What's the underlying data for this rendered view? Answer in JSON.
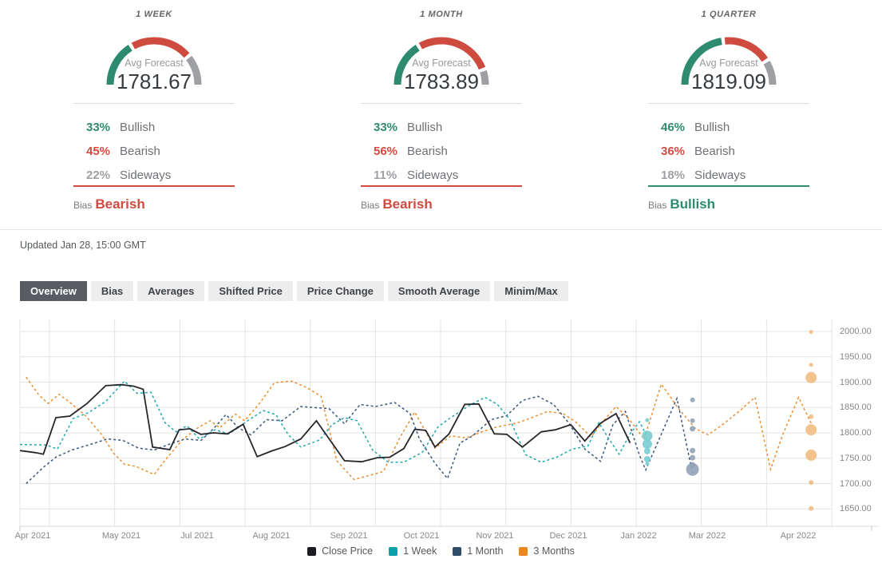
{
  "labels": {
    "updated": "Updated Jan 28, 15:00 GMT"
  },
  "colors": {
    "bullish": "#2e8b6f",
    "bearish": "#cf4b3f",
    "sideways": "#9ea0a3",
    "active_tab_bg": "#595d61",
    "grid": "#e4e4e4",
    "axis_text": "#85888b"
  },
  "cards": [
    {
      "period": "1 WEEK",
      "avg_label": "Avg Forecast",
      "avg_forecast": "1781.67",
      "bullish_pct": "33%",
      "bullish_label": "Bullish",
      "bearish_pct": "45%",
      "bearish_label": "Bearish",
      "sideways_pct": "22%",
      "sideways_label": "Sideways",
      "bias_label": "Bias",
      "bias": "Bearish",
      "bias_direction": "bearish",
      "gauge": {
        "bullish": 33,
        "bearish": 45,
        "sideways": 22
      }
    },
    {
      "period": "1 MONTH",
      "avg_label": "Avg Forecast",
      "avg_forecast": "1783.89",
      "bullish_pct": "33%",
      "bullish_label": "Bullish",
      "bearish_pct": "56%",
      "bearish_label": "Bearish",
      "sideways_pct": "11%",
      "sideways_label": "Sideways",
      "bias_label": "Bias",
      "bias": "Bearish",
      "bias_direction": "bearish",
      "gauge": {
        "bullish": 33,
        "bearish": 56,
        "sideways": 11
      }
    },
    {
      "period": "1 QUARTER",
      "avg_label": "Avg Forecast",
      "avg_forecast": "1819.09",
      "bullish_pct": "46%",
      "bullish_label": "Bullish",
      "bearish_pct": "36%",
      "bearish_label": "Bearish",
      "sideways_pct": "18%",
      "sideways_label": "Sideways",
      "bias_label": "Bias",
      "bias": "Bullish",
      "bias_direction": "bullish",
      "gauge": {
        "bullish": 46,
        "bearish": 36,
        "sideways": 18
      }
    }
  ],
  "tabs": {
    "active": "Overview",
    "items": [
      {
        "label": "Overview"
      },
      {
        "label": "Bias"
      },
      {
        "label": "Averages"
      },
      {
        "label": "Shifted Price"
      },
      {
        "label": "Price Change"
      },
      {
        "label": "Smooth Average"
      },
      {
        "label": "Minim/Max"
      }
    ]
  },
  "chart_data": {
    "type": "line",
    "title": "",
    "xlabel": "",
    "ylabel": "",
    "x_unit": "weeks since Apr 2021 (close price history + forecast horizons)",
    "x_axis": {
      "tick_labels": [
        "Apr 2021",
        "May 2021",
        "Jul 2021",
        "Aug 2021",
        "Sep 2021",
        "Oct 2021",
        "Nov 2021",
        "Dec 2021",
        "Jan 2022",
        "Mar 2022",
        "Apr 2022"
      ]
    },
    "y_axis": {
      "tick_labels": [
        "2000.00",
        "1950.00",
        "1900.00",
        "1850.00",
        "1800.00",
        "1750.00",
        "1700.00",
        "1650.00"
      ],
      "min": 1615,
      "max": 2025,
      "grid": true
    },
    "legend": {
      "position": "bottom",
      "items": [
        {
          "label": "Close Price",
          "color": "#1c1d22"
        },
        {
          "label": "1 Week",
          "color": "#0aa2a8"
        },
        {
          "label": "1 Month",
          "color": "#2f4d6b"
        },
        {
          "label": "3 Months",
          "color": "#e8891d"
        }
      ]
    },
    "series": [
      {
        "name": "Close Price",
        "style": "solid",
        "color": "#26262c",
        "points": [
          [
            0,
            1765
          ],
          [
            1,
            1761
          ],
          [
            1.5,
            1758
          ],
          [
            2.3,
            1830
          ],
          [
            3.2,
            1833
          ],
          [
            4.3,
            1858
          ],
          [
            5.5,
            1893
          ],
          [
            6.5,
            1895
          ],
          [
            7.3,
            1892
          ],
          [
            7.9,
            1886
          ],
          [
            8.5,
            1772
          ],
          [
            9.6,
            1767
          ],
          [
            10.2,
            1806
          ],
          [
            10.9,
            1808
          ],
          [
            11.6,
            1797
          ],
          [
            12.4,
            1800
          ],
          [
            13.3,
            1798
          ],
          [
            14.3,
            1817
          ],
          [
            15.2,
            1753
          ],
          [
            16.1,
            1764
          ],
          [
            17,
            1773
          ],
          [
            18,
            1788
          ],
          [
            19,
            1824
          ],
          [
            20.8,
            1745
          ],
          [
            21.9,
            1743
          ],
          [
            22.9,
            1751
          ],
          [
            23.7,
            1752
          ],
          [
            24.6,
            1769
          ],
          [
            25.3,
            1807
          ],
          [
            26,
            1805
          ],
          [
            26.6,
            1772
          ],
          [
            27.5,
            1798
          ],
          [
            28.5,
            1856
          ],
          [
            29.4,
            1857
          ],
          [
            30.4,
            1798
          ],
          [
            31.2,
            1797
          ],
          [
            32.2,
            1772
          ],
          [
            33.4,
            1802
          ],
          [
            34.3,
            1806
          ],
          [
            35.3,
            1816
          ],
          [
            36.2,
            1784
          ],
          [
            37.2,
            1819
          ],
          [
            38.2,
            1838
          ],
          [
            39.1,
            1780
          ]
        ]
      },
      {
        "name": "1 Week",
        "style": "dashed",
        "color": "#1fa9af",
        "points": [
          [
            0,
            1777
          ],
          [
            1.7,
            1776
          ],
          [
            2.4,
            1768
          ],
          [
            3.4,
            1828
          ],
          [
            4.4,
            1840
          ],
          [
            5.5,
            1862
          ],
          [
            6.7,
            1902
          ],
          [
            7.5,
            1878
          ],
          [
            8.4,
            1880
          ],
          [
            9.3,
            1820
          ],
          [
            10,
            1802
          ],
          [
            10.7,
            1814
          ],
          [
            11.5,
            1788
          ],
          [
            12.5,
            1806
          ],
          [
            13.4,
            1798
          ],
          [
            14.6,
            1824
          ],
          [
            15.6,
            1844
          ],
          [
            16.4,
            1836
          ],
          [
            17.2,
            1796
          ],
          [
            18,
            1772
          ],
          [
            19.2,
            1786
          ],
          [
            20,
            1816
          ],
          [
            20.8,
            1830
          ],
          [
            21.6,
            1824
          ],
          [
            22.6,
            1766
          ],
          [
            23.6,
            1742
          ],
          [
            24.6,
            1742
          ],
          [
            25.8,
            1762
          ],
          [
            26.8,
            1812
          ],
          [
            27.6,
            1830
          ],
          [
            28.8,
            1854
          ],
          [
            29.8,
            1870
          ],
          [
            30.6,
            1856
          ],
          [
            31.4,
            1826
          ],
          [
            32.4,
            1757
          ],
          [
            33.4,
            1742
          ],
          [
            34.4,
            1752
          ],
          [
            35.4,
            1768
          ],
          [
            36.4,
            1774
          ],
          [
            37.1,
            1820
          ],
          [
            37.7,
            1790
          ],
          [
            38.4,
            1758
          ],
          [
            39.1,
            1798
          ],
          [
            39.7,
            1822
          ],
          [
            40.2,
            1792
          ]
        ],
        "forecast_dots": {
          "x": 40.2,
          "color": "#79ccd1",
          "points": [
            [
              1825,
              2.5
            ],
            [
              1794,
              6.5
            ],
            [
              1778,
              6
            ],
            [
              1764,
              4
            ],
            [
              1748,
              4
            ],
            [
              1739,
              2.5
            ]
          ]
        }
      },
      {
        "name": "1 Month",
        "style": "dashed",
        "color": "#3a567a",
        "points": [
          [
            0.4,
            1700
          ],
          [
            1.5,
            1732
          ],
          [
            2.3,
            1752
          ],
          [
            3.3,
            1766
          ],
          [
            4.6,
            1778
          ],
          [
            5.6,
            1788
          ],
          [
            6.6,
            1785
          ],
          [
            7.6,
            1770
          ],
          [
            8.6,
            1766
          ],
          [
            9.6,
            1778
          ],
          [
            10.6,
            1788
          ],
          [
            11.6,
            1785
          ],
          [
            12.4,
            1808
          ],
          [
            13.2,
            1836
          ],
          [
            14,
            1810
          ],
          [
            14.8,
            1796
          ],
          [
            15.8,
            1826
          ],
          [
            16.8,
            1824
          ],
          [
            18,
            1852
          ],
          [
            18.8,
            1850
          ],
          [
            19.8,
            1848
          ],
          [
            20.8,
            1818
          ],
          [
            21.8,
            1856
          ],
          [
            22.8,
            1852
          ],
          [
            24,
            1860
          ],
          [
            25,
            1838
          ],
          [
            25.6,
            1788
          ],
          [
            26.6,
            1740
          ],
          [
            27.4,
            1710
          ],
          [
            28.2,
            1780
          ],
          [
            29,
            1794
          ],
          [
            30.2,
            1826
          ],
          [
            31.2,
            1834
          ],
          [
            32.2,
            1864
          ],
          [
            33.2,
            1872
          ],
          [
            34.2,
            1856
          ],
          [
            35.2,
            1818
          ],
          [
            36.2,
            1768
          ],
          [
            37.2,
            1744
          ],
          [
            38,
            1816
          ],
          [
            38.8,
            1842
          ],
          [
            39.7,
            1756
          ],
          [
            40.1,
            1727
          ],
          [
            42.1,
            1868
          ],
          [
            43.1,
            1720
          ]
        ],
        "forecast_dots": {
          "x": 43.1,
          "color": "#94a2b6",
          "points": [
            [
              1865,
              3
            ],
            [
              1824,
              3
            ],
            [
              1808,
              3.5
            ],
            [
              1765,
              3.5
            ],
            [
              1751,
              3.5
            ],
            [
              1737,
              3.5
            ],
            [
              1728,
              8
            ]
          ]
        }
      },
      {
        "name": "3 Months",
        "style": "dashed",
        "color": "#ea9030",
        "points": [
          [
            0.4,
            1910
          ],
          [
            1.2,
            1875
          ],
          [
            1.8,
            1858
          ],
          [
            2.5,
            1876
          ],
          [
            3.2,
            1860
          ],
          [
            4.2,
            1834
          ],
          [
            5.2,
            1798
          ],
          [
            6,
            1760
          ],
          [
            6.7,
            1738
          ],
          [
            7.4,
            1734
          ],
          [
            8.6,
            1718
          ],
          [
            9.4,
            1750
          ],
          [
            10.4,
            1786
          ],
          [
            11.4,
            1810
          ],
          [
            12.2,
            1824
          ],
          [
            12.8,
            1810
          ],
          [
            13.8,
            1837
          ],
          [
            14.4,
            1824
          ],
          [
            15.4,
            1860
          ],
          [
            16.3,
            1899
          ],
          [
            17.4,
            1902
          ],
          [
            18.4,
            1889
          ],
          [
            19.3,
            1872
          ],
          [
            20.3,
            1745
          ],
          [
            21.4,
            1708
          ],
          [
            22.4,
            1716
          ],
          [
            23.3,
            1724
          ],
          [
            24.3,
            1788
          ],
          [
            25.3,
            1841
          ],
          [
            26.6,
            1770
          ],
          [
            27.6,
            1794
          ],
          [
            28.6,
            1790
          ],
          [
            29.6,
            1802
          ],
          [
            30.6,
            1812
          ],
          [
            31.8,
            1819
          ],
          [
            32.8,
            1830
          ],
          [
            33.8,
            1842
          ],
          [
            34.8,
            1838
          ],
          [
            35.6,
            1822
          ],
          [
            36.6,
            1792
          ],
          [
            37.4,
            1824
          ],
          [
            38.2,
            1852
          ],
          [
            39,
            1828
          ],
          [
            40,
            1788
          ],
          [
            41.1,
            1896
          ],
          [
            42.2,
            1848
          ],
          [
            43.3,
            1808
          ],
          [
            44.1,
            1796
          ],
          [
            45.1,
            1818
          ],
          [
            46.1,
            1843
          ],
          [
            47.1,
            1870
          ],
          [
            48.1,
            1728
          ],
          [
            48.9,
            1798
          ],
          [
            49.9,
            1870
          ],
          [
            50.8,
            1813
          ]
        ],
        "forecast_dots": {
          "x": 50.7,
          "color": "#f2bc82",
          "points": [
            [
              1999,
              2.5
            ],
            [
              1934,
              2.5
            ],
            [
              1909,
              7
            ],
            [
              1832,
              3
            ],
            [
              1806,
              7
            ],
            [
              1756,
              7
            ],
            [
              1702,
              3
            ],
            [
              1651,
              3
            ]
          ]
        }
      }
    ]
  }
}
